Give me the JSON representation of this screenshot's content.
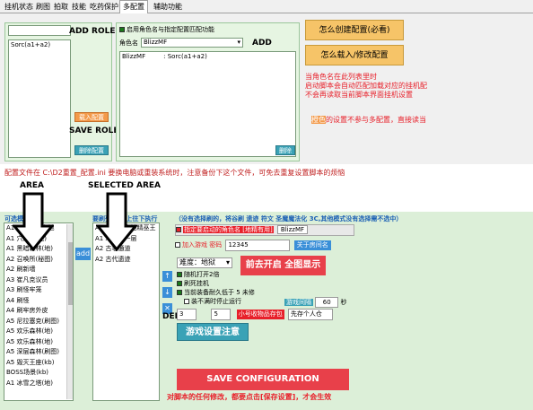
{
  "tabs": [
    "挂机状态",
    "刷图",
    "拍取",
    "技能",
    "吃药保护",
    "多配置",
    "辅助功能"
  ],
  "active_tab_index": 5,
  "left_list": {
    "input_value": "",
    "items": [
      "Sorc(a1+a2)"
    ]
  },
  "mid_check_label": "启用角色名与指定配置匹配功能",
  "role_name_label": "角色名",
  "role_name_value": "BlizzMF",
  "mid_list": {
    "row_name": "BlizzMF",
    "row_sep": ":",
    "row_value": "Sorc(a1+a2)"
  },
  "buttons": {
    "load_config": "载入配置",
    "delete_config": "删除配置",
    "delete": "删除",
    "how_create": "怎么创建配置(必看)",
    "how_load": "怎么载入/修改配置"
  },
  "overlay": {
    "add_role": "ADD ROLE",
    "save_role": "SAVE ROLE",
    "add": "ADD",
    "area": "AREA",
    "selected_area": "SELECTED AREA",
    "add_small": "add",
    "del": "DEL",
    "save_config": "SAVE CONFIGURATION"
  },
  "notes": {
    "line1": "当角色名在此列表里时",
    "line2": "启动脚本会自动匹配加载对应的挂机配",
    "line3": "不会再读取当前脚本界面挂机设置",
    "grey_prefix": "橙色",
    "grey_rest": "的设置不参与多配置，直接读当"
  },
  "config_file_note": "配置文件在 C:\\D2重置_配置.ini    要换电脑或重装系统时，注意备份下这个文件，可免去重复设置脚本的烦恼",
  "bottom": {
    "left_title": "可选模式",
    "mid_title": "要刷列表 从上往下执行",
    "hint": "（没有选择刷的，将谷刷  遗迹  符文  圣魔魔法化 3C,其他模式没有选择需不选中）",
    "left_items": [
      "A1 邪恶平乐之地",
      "A1 穴居地(地)",
      "A1 黑暗森林(地)",
      "A2 召唤所(秘图)",
      "A2 刷新墙",
      "A3 崔凡克议员",
      "A3 刷怪牢笼",
      "A4 刷怪",
      "A4 刷牢房外皮",
      "A5 尼拉塞克(刷图)",
      "A5 欢乐森林(地)",
      "A5 欢乐森林(地)",
      "A5 深层森林(刷图)",
      "A5 毁灭王座(kb)",
      "BOSS场景(kb)",
      "A1 冰雪之塔(地)"
    ],
    "mid_items": [
      "A1 崔斯特之地精巫王",
      "A1 地穴第一层",
      "A2 古老通道",
      "A2 古代遗迹"
    ],
    "role_check_label": "指定要启动的角色名 [地精有用]",
    "role_value": "BlizzMF",
    "room_check_label": "加入游戏 密码",
    "room_value": "12345",
    "room_btn": "关于房间名",
    "difficulty_label": "难度：地狱",
    "start_btn": "前去开启 全图显示",
    "opt1": "随机打开2倍",
    "opt2": "刷死挂机",
    "opt3": "当前装备耐久低于 5 未修",
    "opt4": "装不满时停止运行",
    "speed_label": "游戏间隔",
    "speed_value": "60",
    "speed_unit": "秒",
    "num1": "3",
    "num2": "5",
    "red_tag": "小号收物品存包",
    "pick_select": "先存个人仓",
    "game_set_btn": "游戏设置注意",
    "save_note": "对脚本的任何修改，都要点击[保存设置]，才会生效"
  },
  "colors": {
    "orange": "#f39a4a",
    "red": "#e8202a",
    "teal": "#3aa2b6",
    "blue": "#1a5fb4"
  }
}
